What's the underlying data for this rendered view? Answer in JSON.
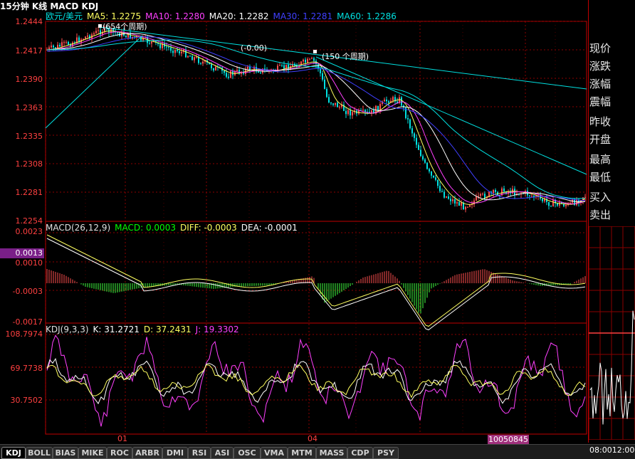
{
  "title": "15分钟 K线 MACD KDJ",
  "price_panel": {
    "header": [
      {
        "text": "欧元/美元",
        "color": "#00e0e0"
      },
      {
        "text": "MA5: 1.2275",
        "color": "#ffff60"
      },
      {
        "text": "MA10: 1.2280",
        "color": "#ff40ff"
      },
      {
        "text": "MA20: 1.2282",
        "color": "#ffffff"
      },
      {
        "text": "MA30: 1.2281",
        "color": "#4040ff"
      },
      {
        "text": "MA60: 1.2286",
        "color": "#00e0e0"
      }
    ],
    "y_labels": [
      "1.2444",
      "1.2417",
      "1.2390",
      "1.2363",
      "1.2335",
      "1.2308",
      "1.2281",
      "1.2254"
    ],
    "annotations": {
      "a1": "(654个周期)",
      "a2": "(-0.00)",
      "a3": "(150 个周期)"
    }
  },
  "macd_panel": {
    "header": [
      {
        "text": "MACD(26,12,9)",
        "color": "#e0e0e0"
      },
      {
        "text": "MACD: 0.0003",
        "color": "#00ff00"
      },
      {
        "text": "DIFF: -0.0003",
        "color": "#ffff60"
      },
      {
        "text": "DEA: -0.0001",
        "color": "#ffffff"
      }
    ],
    "y_labels": [
      "0.0023",
      "0.0010",
      "-0.0003",
      "-0.0017"
    ],
    "cursor_value": "0.0013"
  },
  "kdj_panel": {
    "header": [
      {
        "text": "KDJ(9,3,3)",
        "color": "#e0e0e0"
      },
      {
        "text": "K: 31.2721",
        "color": "#ffffff"
      },
      {
        "text": "D: 37.2431",
        "color": "#ffff60"
      },
      {
        "text": "J: 19.3302",
        "color": "#ff40ff"
      }
    ],
    "y_labels": [
      "108.7974",
      "69.7738",
      "30.7502"
    ]
  },
  "x_axis": {
    "labels": [
      "01",
      "04"
    ],
    "cursor_date": "10050845"
  },
  "right_panel": {
    "items": [
      "现价",
      "涨跌",
      "涨幅",
      "震幅",
      "昨收",
      "开盘",
      "最高",
      "最低",
      "买入",
      "卖出"
    ]
  },
  "tabs": [
    "KDJ",
    "BOLL",
    "BIAS",
    "MIKE",
    "ROC",
    "ARBR",
    "DMI",
    "RSI",
    "ASI",
    "OSC",
    "VMA",
    "MTM",
    "MASS",
    "CDP",
    "PSY"
  ],
  "active_tab": "KDJ",
  "time_readout": "08:0012:00",
  "colors": {
    "grid": "#8b0000",
    "up": "#ff5050",
    "down": "#00e0e0",
    "accent": "#c00000"
  }
}
